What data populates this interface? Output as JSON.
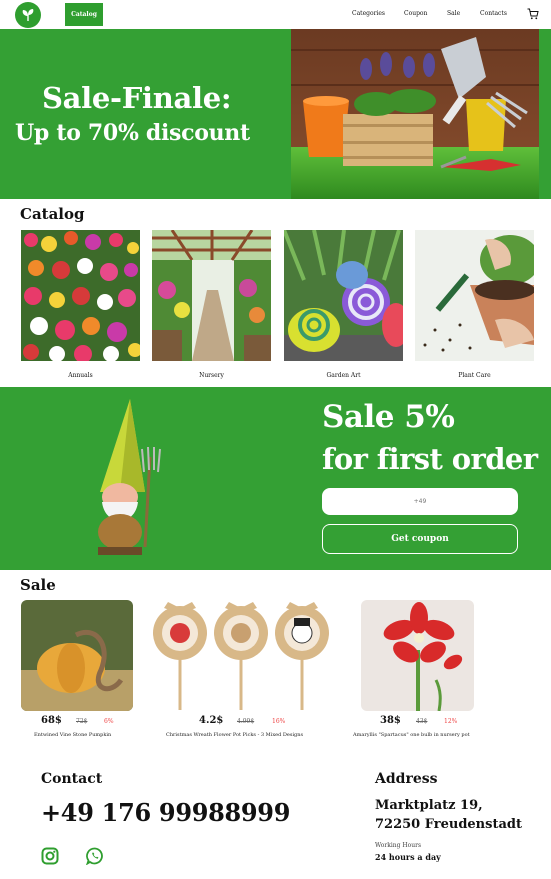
{
  "header": {
    "catalog_label": "Catalog",
    "nav": [
      "Categories",
      "Coupon",
      "Sale",
      "Contacts"
    ]
  },
  "hero": {
    "line1": "Sale-Finale:",
    "line2": "Up to 70% discount"
  },
  "catalog": {
    "title": "Catalog",
    "items": [
      {
        "label": "Annuals",
        "icon": "flowers-photo"
      },
      {
        "label": "Nursery",
        "icon": "greenhouse-photo"
      },
      {
        "label": "Garden Art",
        "icon": "snail-art-photo"
      },
      {
        "label": "Plant Care",
        "icon": "potting-photo"
      }
    ]
  },
  "promo": {
    "line1": "Sale 5%",
    "line2": "for first order",
    "phone_placeholder": "+49",
    "button_label": "Get coupon"
  },
  "sale": {
    "title": "Sale",
    "products": [
      {
        "price": "68$",
        "old_price": "72$",
        "discount": "6%",
        "name": "Entwined Vine Stone Pumpkin"
      },
      {
        "price": "4.2$",
        "old_price": "4.99$",
        "discount": "16%",
        "name": "Christmas Wreath Flower Pot Picks - 3 Mixed Designs"
      },
      {
        "price": "38$",
        "old_price": "43$",
        "discount": "12%",
        "name": "Amaryllis \"Spartacus\" one bulb in nursery pot"
      }
    ]
  },
  "footer": {
    "contact_title": "Contact",
    "phone": "+49 176 99988999",
    "address_title": "Address",
    "address_line1": "Marktplatz 19,",
    "address_line2": "72250 Freudenstadt",
    "hours_label": "Working Hours",
    "hours_value": "24 hours a day"
  },
  "colors": {
    "brand_green": "#34a034",
    "discount_red": "#e44444"
  }
}
